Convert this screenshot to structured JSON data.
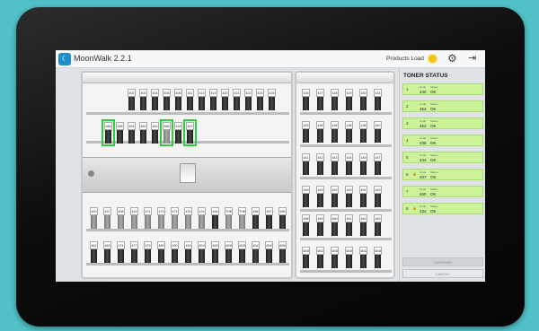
{
  "app": {
    "title": "MoonWalk 2.2.1",
    "logo_icon": "app-logo-icon"
  },
  "header": {
    "status_label": "Products Load",
    "status_color": "#f1c40f"
  },
  "cabinet": {
    "left_top_row1": [
      "402",
      "403",
      "404",
      "405",
      "406",
      "411",
      "413",
      "415",
      "420",
      "421",
      "422",
      "423",
      "425"
    ],
    "left_top_row2": [
      {
        "label": "468",
        "selected": true
      },
      {
        "label": "448",
        "selected": false
      },
      {
        "label": "454",
        "selected": false
      },
      {
        "label": "463",
        "selected": false
      },
      {
        "label": "444",
        "selected": false
      },
      {
        "label": "466",
        "selected": true,
        "light": true
      },
      {
        "label": "418",
        "selected": false
      },
      {
        "label": "407",
        "selected": true
      }
    ],
    "left_bottom_row1": [
      {
        "label": "400",
        "light": true
      },
      {
        "label": "437",
        "light": true
      },
      {
        "label": "408",
        "light": true
      },
      {
        "label": "414",
        "light": true
      },
      {
        "label": "471",
        "light": true
      },
      {
        "label": "473",
        "light": true
      },
      {
        "label": "472",
        "light": true
      },
      {
        "label": "475",
        "light": true
      },
      {
        "label": "476",
        "light": true
      },
      {
        "label": "494",
        "light": false
      },
      {
        "label": "THEB",
        "light": true
      },
      {
        "label": "THEB",
        "light": true
      },
      {
        "label": "456",
        "light": false
      },
      {
        "label": "457",
        "light": false
      },
      {
        "label": "495",
        "light": false
      }
    ],
    "left_bottom_row2": [
      "462",
      "463",
      "474",
      "477",
      "479",
      "489",
      "490",
      "493",
      "4010",
      "4033",
      "4036",
      "4035",
      "4041",
      "4049",
      "4054"
    ],
    "right_top_row1": [
      "426",
      "427",
      "428",
      "429",
      "430",
      "431"
    ],
    "right_top_row2": [
      "433",
      "435",
      "435",
      "136",
      "138",
      "440"
    ],
    "right_top_row3": [
      "441",
      "442",
      "443",
      "444",
      "445",
      "447"
    ],
    "right_top_row4": [
      "448",
      "453",
      "452",
      "453",
      "454",
      "453"
    ],
    "right_bottom_row1": [
      "458",
      "459",
      "460",
      "461",
      "462",
      "463"
    ],
    "right_bottom_row2": [
      "4036",
      "4037",
      "4038",
      "4040",
      "4042",
      "4048"
    ]
  },
  "sidebar": {
    "title": "TONER STATUS",
    "col_label": "Code",
    "status_label": "Status",
    "toners": [
      {
        "num": "1",
        "lock": false,
        "code": "440",
        "status": "OK"
      },
      {
        "num": "2",
        "lock": false,
        "code": "454",
        "status": "OK"
      },
      {
        "num": "3",
        "lock": false,
        "code": "462",
        "status": "OK"
      },
      {
        "num": "4",
        "lock": false,
        "code": "438",
        "status": "OK"
      },
      {
        "num": "5",
        "lock": false,
        "code": "444",
        "status": "OK"
      },
      {
        "num": "6",
        "lock": true,
        "code": "407",
        "status": "OK"
      },
      {
        "num": "7",
        "lock": false,
        "code": "460",
        "status": "OK"
      },
      {
        "num": "8",
        "lock": true,
        "code": "434",
        "status": "OK"
      }
    ],
    "buttons": {
      "dispense": "DISPENSE",
      "cancel": "CANCEL"
    }
  },
  "colors": {
    "ok_green": "#ccf29a",
    "selection_green": "#2ecc40"
  }
}
